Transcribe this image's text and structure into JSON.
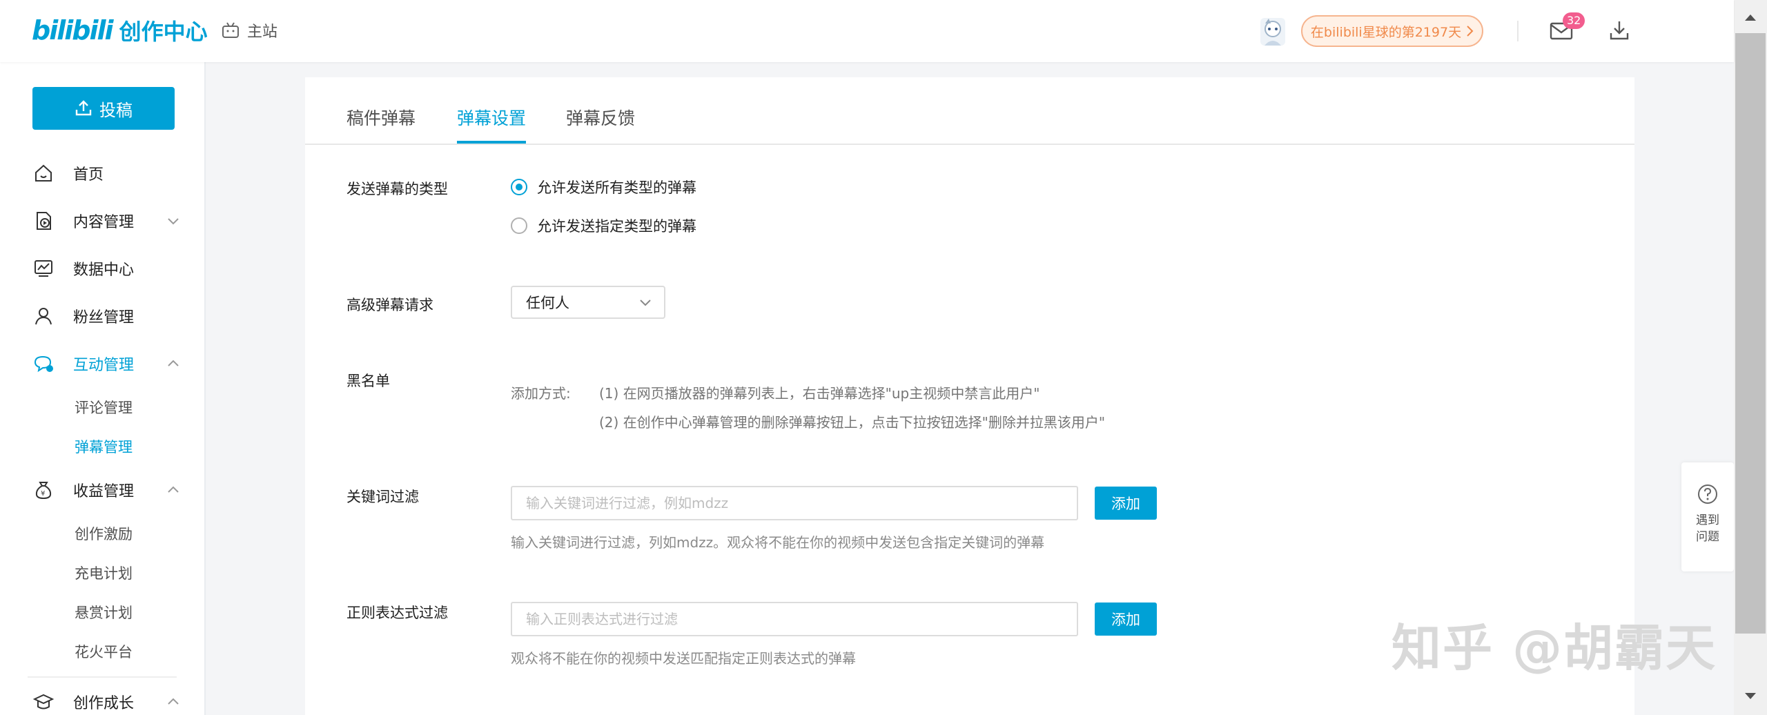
{
  "header": {
    "logo_bili": "bilibili",
    "logo_text": "创作中心",
    "home_link": "主站",
    "planet_badge": "在bilibili星球的第2197天",
    "mail_count": "32"
  },
  "sidebar": {
    "upload_label": "投稿",
    "items": [
      {
        "label": "首页"
      },
      {
        "label": "内容管理"
      },
      {
        "label": "数据中心"
      },
      {
        "label": "粉丝管理"
      },
      {
        "label": "互动管理"
      }
    ],
    "interaction_sub": [
      {
        "label": "评论管理"
      },
      {
        "label": "弹幕管理"
      }
    ],
    "income": {
      "label": "收益管理"
    },
    "income_sub": [
      {
        "label": "创作激励"
      },
      {
        "label": "充电计划"
      },
      {
        "label": "悬赏计划"
      },
      {
        "label": "花火平台"
      }
    ],
    "growth": {
      "label": "创作成长"
    }
  },
  "tabs": [
    {
      "label": "稿件弹幕"
    },
    {
      "label": "弹幕设置"
    },
    {
      "label": "弹幕反馈"
    }
  ],
  "settings": {
    "type_label": "发送弹幕的类型",
    "type_options": [
      {
        "label": "允许发送所有类型的弹幕",
        "checked": true
      },
      {
        "label": "允许发送指定类型的弹幕",
        "checked": false
      }
    ],
    "advanced_label": "高级弹幕请求",
    "advanced_value": "任何人",
    "blacklist_label": "黑名单",
    "blacklist_prefix": "添加方式:",
    "blacklist_line1": "(1) 在网页播放器的弹幕列表上，右击弹幕选择\"up主视频中禁言此用户\"",
    "blacklist_line2": "(2) 在创作中心弹幕管理的删除弹幕按钮上，点击下拉按钮选择\"删除并拉黑该用户\"",
    "keyword_label": "关键词过滤",
    "keyword_placeholder": "输入关键词进行过滤，例如mdzz",
    "keyword_hint": "输入关键词进行过滤，列如mdzz。观众将不能在你的视频中发送包含指定关键词的弹幕",
    "regex_label": "正则表达式过滤",
    "regex_placeholder": "输入正则表达式进行过滤",
    "regex_hint": "观众将不能在你的视频中发送匹配指定正则表达式的弹幕",
    "add_label": "添加"
  },
  "help": {
    "line1": "遇到",
    "line2": "问题"
  },
  "watermark": "知乎 @胡霸天",
  "colors": {
    "accent": "#00a1d6",
    "badge": "#f25d8e",
    "planet_border": "#f6b48e"
  }
}
